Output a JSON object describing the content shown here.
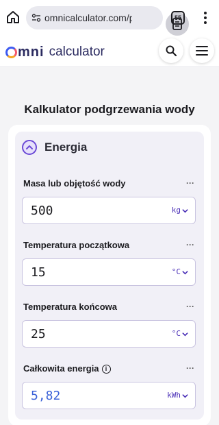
{
  "browser": {
    "url": "omnicalculator.com/pl",
    "tab_count": "55"
  },
  "site": {
    "logo_mark": "mni",
    "logo_text": "calculator"
  },
  "page": {
    "title": "Kalkulator podgrzewania wody"
  },
  "section": {
    "title": "Energia",
    "fields": [
      {
        "label": "Masa lub objętość wody",
        "value": "500",
        "unit": "kg",
        "more": "···"
      },
      {
        "label": "Temperatura początkowa",
        "value": "15",
        "unit": "°C",
        "more": "···"
      },
      {
        "label": "Temperatura końcowa",
        "value": "25",
        "unit": "°C",
        "more": "···"
      },
      {
        "label": "Całkowita energia",
        "info": "i",
        "value": "5,82",
        "unit": "kWh",
        "more": "···"
      }
    ]
  },
  "colors": {
    "accent": "#6c4bd6",
    "result": "#3b62d8",
    "unit": "#4a2fb7"
  }
}
